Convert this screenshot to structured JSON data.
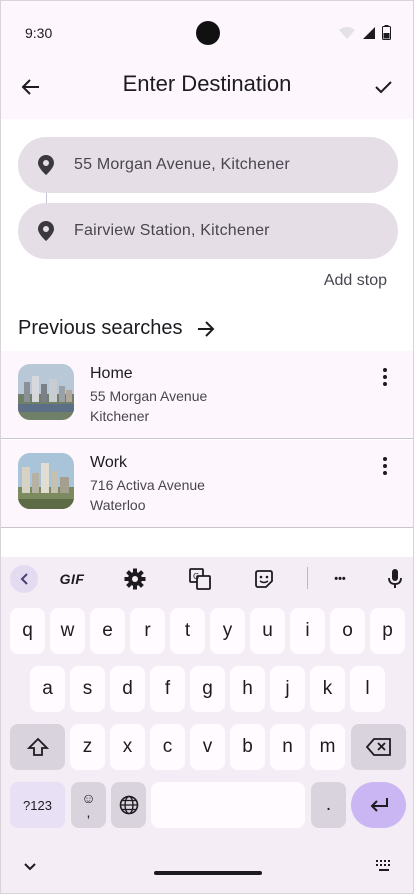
{
  "status_bar": {
    "time": "9:30"
  },
  "app_bar": {
    "title": "Enter Destination",
    "back_icon": "arrow-left-icon",
    "confirm_icon": "check-icon"
  },
  "route": {
    "origin": "55 Morgan Avenue, Kitchener",
    "destination": "Fairview Station, Kitchener",
    "add_stop_label": "Add stop"
  },
  "previous": {
    "heading": "Previous searches",
    "items": [
      {
        "name": "Home",
        "street": "55 Morgan Avenue",
        "city": "Kitchener"
      },
      {
        "name": "Work",
        "street": "716 Activa Avenue",
        "city": "Waterloo"
      }
    ]
  },
  "keyboard": {
    "toolbar": {
      "gif_label": "GIF",
      "more_label": "•••"
    },
    "row1": [
      "q",
      "w",
      "e",
      "r",
      "t",
      "y",
      "u",
      "i",
      "o",
      "p"
    ],
    "row2": [
      "a",
      "s",
      "d",
      "f",
      "g",
      "h",
      "j",
      "k",
      "l"
    ],
    "row3": [
      "z",
      "x",
      "c",
      "v",
      "b",
      "n",
      "m"
    ],
    "symbols_label": "?123",
    "comma_label": ",",
    "period_label": ".",
    "emoji_glyph": "☺"
  },
  "colors": {
    "background": "#fdf7fd",
    "field": "#e5dee7",
    "accent": "#c9b6f2"
  }
}
